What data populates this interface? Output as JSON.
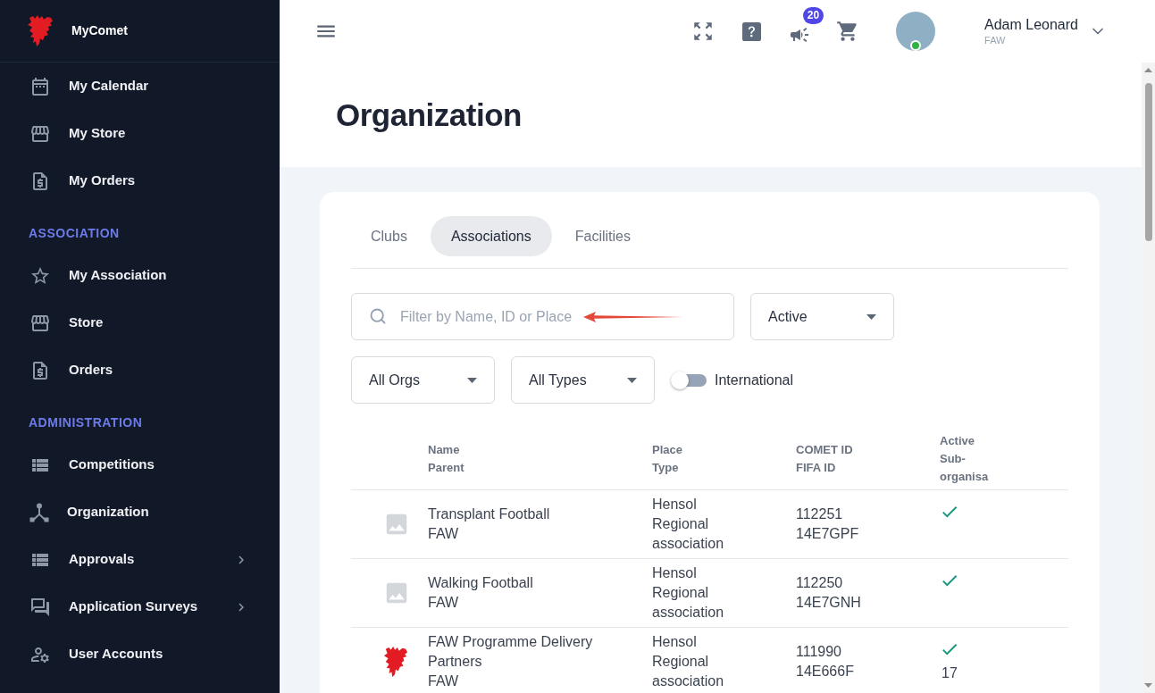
{
  "sidebar": {
    "brand": "MyComet",
    "groups": [
      {
        "items": [
          {
            "label": "My Calendar",
            "submenu": false
          },
          {
            "label": "My Store",
            "submenu": false
          },
          {
            "label": "My Orders",
            "submenu": false
          }
        ]
      },
      {
        "heading": "ASSOCIATION",
        "items": [
          {
            "label": "My Association",
            "submenu": false
          },
          {
            "label": "Store",
            "submenu": false
          },
          {
            "label": "Orders",
            "submenu": false
          }
        ]
      },
      {
        "heading": "ADMINISTRATION",
        "items": [
          {
            "label": "Competitions",
            "submenu": false
          },
          {
            "label": "Organization",
            "submenu": false
          },
          {
            "label": "Approvals",
            "submenu": true
          },
          {
            "label": "Application Surveys",
            "submenu": true
          },
          {
            "label": "User Accounts",
            "submenu": false
          }
        ]
      }
    ]
  },
  "header": {
    "notification_count": "20",
    "user": {
      "name": "Adam Leonard",
      "org": "FAW"
    }
  },
  "page_title": "Organization",
  "tabs": [
    {
      "label": "Clubs",
      "selected": false
    },
    {
      "label": "Associations",
      "selected": true
    },
    {
      "label": "Facilities",
      "selected": false
    }
  ],
  "filters": {
    "search": {
      "placeholder": "Filter by Name, ID or Place"
    },
    "status": {
      "value": "Active"
    },
    "orgs": {
      "value": "All Orgs"
    },
    "types": {
      "value": "All Types"
    },
    "international": {
      "label": "International",
      "on": false
    }
  },
  "table": {
    "columns": [
      {
        "lines": [
          "Name",
          "Parent"
        ]
      },
      {
        "lines": [
          "Place",
          "Type"
        ]
      },
      {
        "lines": [
          "COMET ID",
          "FIFA ID"
        ]
      },
      {
        "lines": [
          "Active",
          "Sub-organisa"
        ]
      }
    ],
    "rows": [
      {
        "has_logo": false,
        "name": "Transplant Football",
        "parent": "FAW",
        "place": "Hensol",
        "type": "Regional association",
        "comet_id": "112251",
        "fifa_id": "14E7GPF",
        "active": true
      },
      {
        "has_logo": false,
        "name": "Walking Football",
        "parent": "FAW",
        "place": "Hensol",
        "type": "Regional association",
        "comet_id": "112250",
        "fifa_id": "14E7GNH",
        "active": true
      },
      {
        "has_logo": true,
        "name": "FAW Programme Delivery Partners",
        "parent": "FAW",
        "place": "Hensol",
        "type": "Regional association",
        "comet_id": "111990",
        "fifa_id": "14E666F",
        "active": true,
        "sub_organisations": "17"
      }
    ]
  }
}
